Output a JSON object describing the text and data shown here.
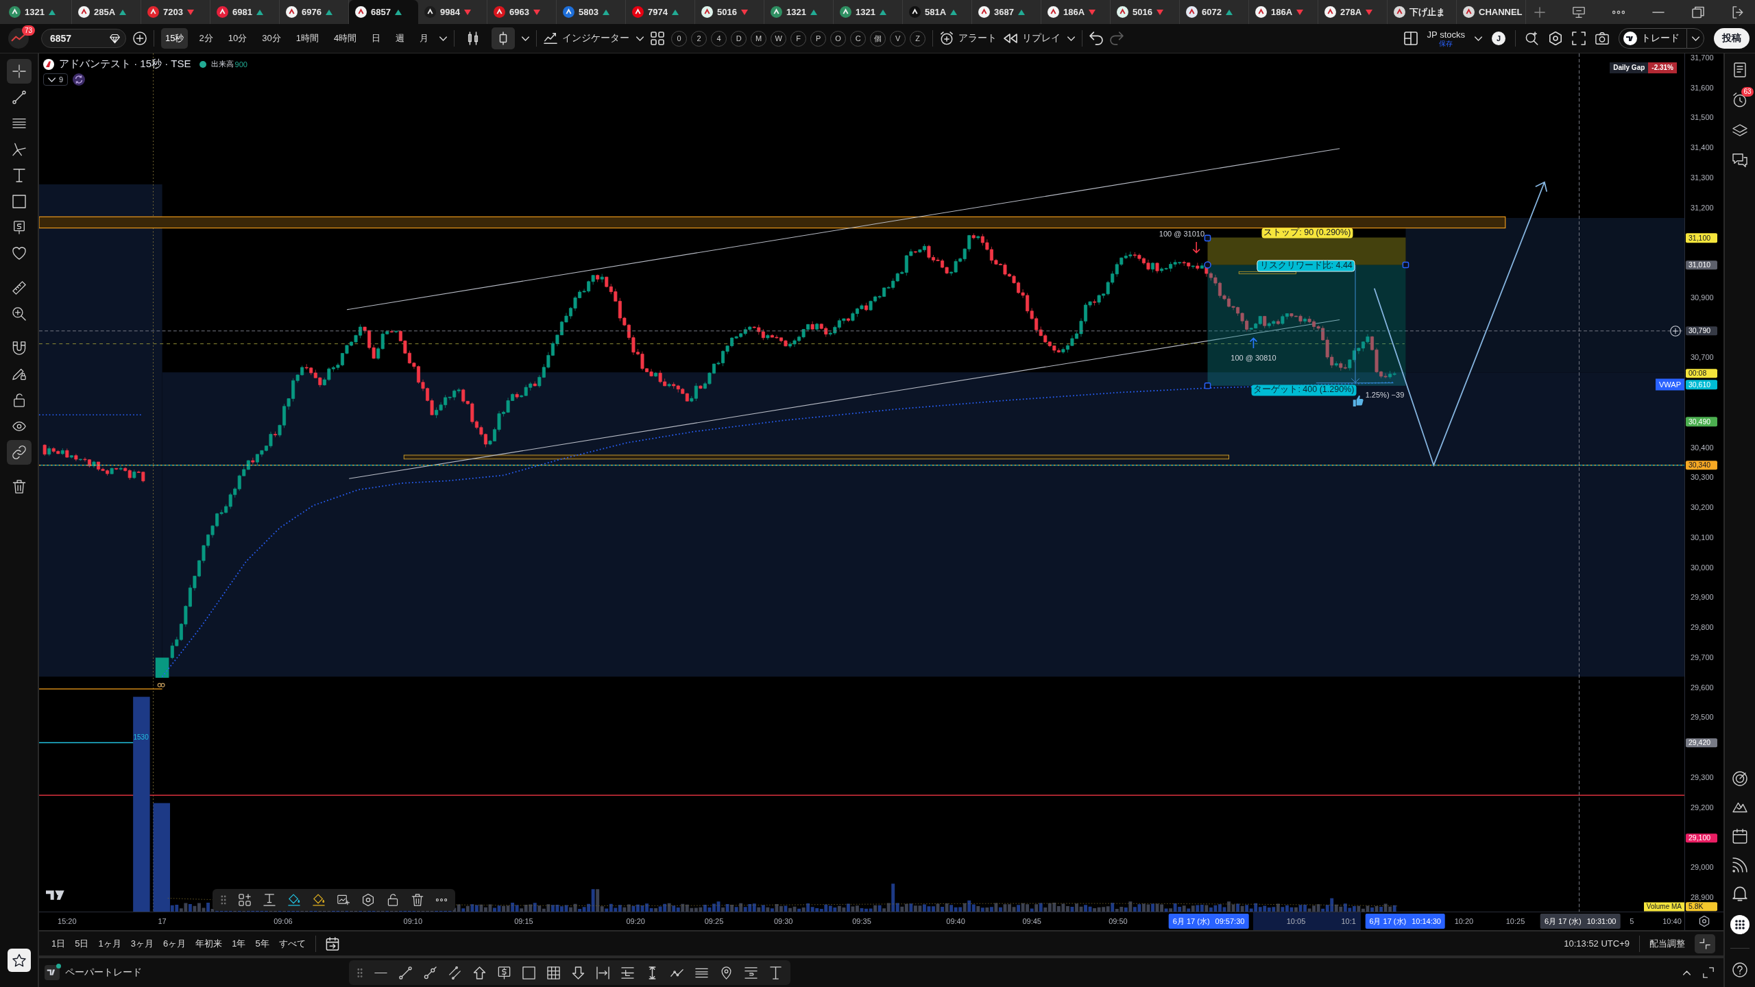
{
  "tabs": [
    {
      "symbol": "1321",
      "up": true,
      "color": "#2f8f62",
      "selected": false
    },
    {
      "symbol": "285A",
      "up": true,
      "color": "#f2f2f2",
      "selected": false
    },
    {
      "symbol": "7203",
      "up": false,
      "color": "#e3262f",
      "selected": false
    },
    {
      "symbol": "6981",
      "up": true,
      "color": "#e5203c",
      "selected": false
    },
    {
      "symbol": "6976",
      "up": true,
      "color": "#f4f4f4",
      "selected": false
    },
    {
      "symbol": "6857",
      "up": true,
      "color": "#f4f4f4",
      "selected": true
    },
    {
      "symbol": "9984",
      "up": false,
      "color": "#1c1c1c",
      "selected": false
    },
    {
      "symbol": "6963",
      "up": false,
      "color": "#d9161e",
      "selected": false
    },
    {
      "symbol": "5803",
      "up": true,
      "color": "#1e6fd9",
      "selected": false
    },
    {
      "symbol": "7974",
      "up": true,
      "color": "#e60012",
      "selected": false
    },
    {
      "symbol": "5016",
      "up": false,
      "color": "#dff3ec",
      "selected": false
    },
    {
      "symbol": "1321",
      "up": true,
      "color": "#2f8f62",
      "selected": false
    },
    {
      "symbol": "1321",
      "up": true,
      "color": "#2f8f62",
      "selected": false
    },
    {
      "symbol": "581A",
      "up": true,
      "color": "#111111",
      "selected": false
    },
    {
      "symbol": "3687",
      "up": true,
      "color": "#f4f4f4",
      "selected": false
    },
    {
      "symbol": "186A",
      "up": false,
      "color": "#f4f4f4",
      "selected": false
    },
    {
      "symbol": "5016",
      "up": false,
      "color": "#dff3ec",
      "selected": false
    },
    {
      "symbol": "6072",
      "up": true,
      "color": "#e3e8f2",
      "selected": false
    },
    {
      "symbol": "186A",
      "up": false,
      "color": "#f4f4f4",
      "selected": false
    },
    {
      "symbol": "278A",
      "up": false,
      "color": "#f4f4f4",
      "selected": false
    },
    {
      "symbol": "下げ止ま",
      "color": "#d9d9d9",
      "selected": false
    },
    {
      "symbol": "CHANNEL",
      "color": "#d9d9d9",
      "selected": false
    }
  ],
  "toolbar": {
    "notification_count": "73",
    "symbol": "6857",
    "intervals": [
      {
        "label": "15秒",
        "selected": true
      },
      {
        "label": "2分",
        "selected": false
      },
      {
        "label": "10分",
        "selected": false
      },
      {
        "label": "30分",
        "selected": false
      },
      {
        "label": "1時間",
        "selected": false
      },
      {
        "label": "4時間",
        "selected": false
      },
      {
        "label": "日",
        "selected": false
      },
      {
        "label": "週",
        "selected": false
      },
      {
        "label": "月",
        "selected": false
      }
    ],
    "chart_types": [
      {
        "selected": false
      },
      {
        "selected": true
      }
    ],
    "indicators": "インジケーター",
    "quick_buttons": [
      "0",
      "2",
      "4",
      "D",
      "M",
      "W",
      "F",
      "P",
      "O",
      "C",
      "個",
      "V",
      "Z"
    ],
    "alert": "アラート",
    "replay": "リプレイ",
    "layout_name": "JP stocks",
    "layout_status": "保存",
    "user_initial": "J",
    "trade": "トレード",
    "publish": "投稿"
  },
  "left_toolbar": [
    {
      "selected": true
    },
    {
      "selected": false
    },
    {
      "selected": false
    },
    {
      "selected": false
    },
    {
      "selected": false
    },
    {
      "selected": false
    },
    {
      "selected": false
    },
    {
      "selected": false
    },
    {
      "selected": false
    },
    {
      "selected": false
    },
    {
      "selected": false
    },
    {
      "selected": false
    },
    {
      "selected": false
    },
    {
      "selected": false
    },
    {
      "selected": true
    },
    {
      "selected": false
    }
  ],
  "chart": {
    "title": "アドバンテスト · 15秒 · TSE",
    "market_open": true,
    "volume_label": "出来高",
    "volume_value": "900",
    "indicators_count": "9",
    "daily_gap_label": "Daily Gap",
    "daily_gap_value": "-2.31%",
    "price_ticks": [
      "31,700",
      "31,600",
      "31,500",
      "31,400",
      "31,300",
      "31,200",
      "30,900",
      "30,700",
      "30,400",
      "30,300",
      "30,200",
      "30,100",
      "30,000",
      "29,900",
      "29,800",
      "29,700",
      "29,600",
      "29,500",
      "29,300",
      "29,200",
      "29,000",
      "28,900"
    ],
    "price_badges": [
      {
        "label": "31,100",
        "color": "#f5e53c"
      },
      {
        "label": "31,010",
        "color": "#5d606b"
      },
      {
        "label": "30,790",
        "color": "#363a45"
      },
      {
        "label": "00:08",
        "color": "#f5e53c"
      },
      {
        "label": "30,610",
        "color": "#00bcd4"
      },
      {
        "label": "30,490",
        "color": "#4caf50"
      },
      {
        "label": "30,340",
        "color": "#f7a823"
      },
      {
        "label": "29,420",
        "color": "#787b86"
      },
      {
        "label": "29,100",
        "color": "#e91e63"
      },
      {
        "label": "5.8K",
        "color": "#f5c72c"
      }
    ],
    "vwap_label": "VWAP",
    "volume_ma_label": "Volume MA",
    "position": {
      "stop_label": "ストップ: 90 (0.290%)",
      "ratio_label": "リスクリワード比: 4.44",
      "target_label": "ターゲット: 400 (1.290%)"
    },
    "notes": [
      {
        "text": "100 @ 31010",
        "kind": "sell"
      },
      {
        "text": "100 @ 30810",
        "kind": "buy"
      },
      {
        "text": "1.25%) −39",
        "kind": "result"
      },
      {
        "text": "1530",
        "kind": "level"
      }
    ],
    "time_labels": [
      "15:20",
      "17",
      "09:06",
      "09:10",
      "09:15",
      "09:20",
      "09:25",
      "09:30",
      "09:35",
      "09:40",
      "09:45",
      "09:50",
      "10:05",
      "10:1",
      "10:20",
      "10:25",
      "5",
      "10:40"
    ],
    "time_highlights": [
      {
        "date": "6月 17 (水)",
        "time": "09:57:30",
        "kind": "range"
      },
      {
        "date": "6月 17 (水)",
        "time": "10:14:30",
        "kind": "range"
      },
      {
        "date": "6月 17 (水)",
        "time": "10:31:00",
        "kind": "cursor"
      }
    ]
  },
  "range_bar": {
    "ranges": [
      "1日",
      "5日",
      "1ヶ月",
      "3ヶ月",
      "6ヶ月",
      "年初来",
      "1年",
      "5年",
      "すべて"
    ],
    "clock": "10:13:52 UTC+9",
    "adjust": "配当調整"
  },
  "trading_panel": {
    "label": "ペーパートレード",
    "connected": true
  },
  "right_sidebar": {
    "alerts_badge": "63"
  }
}
